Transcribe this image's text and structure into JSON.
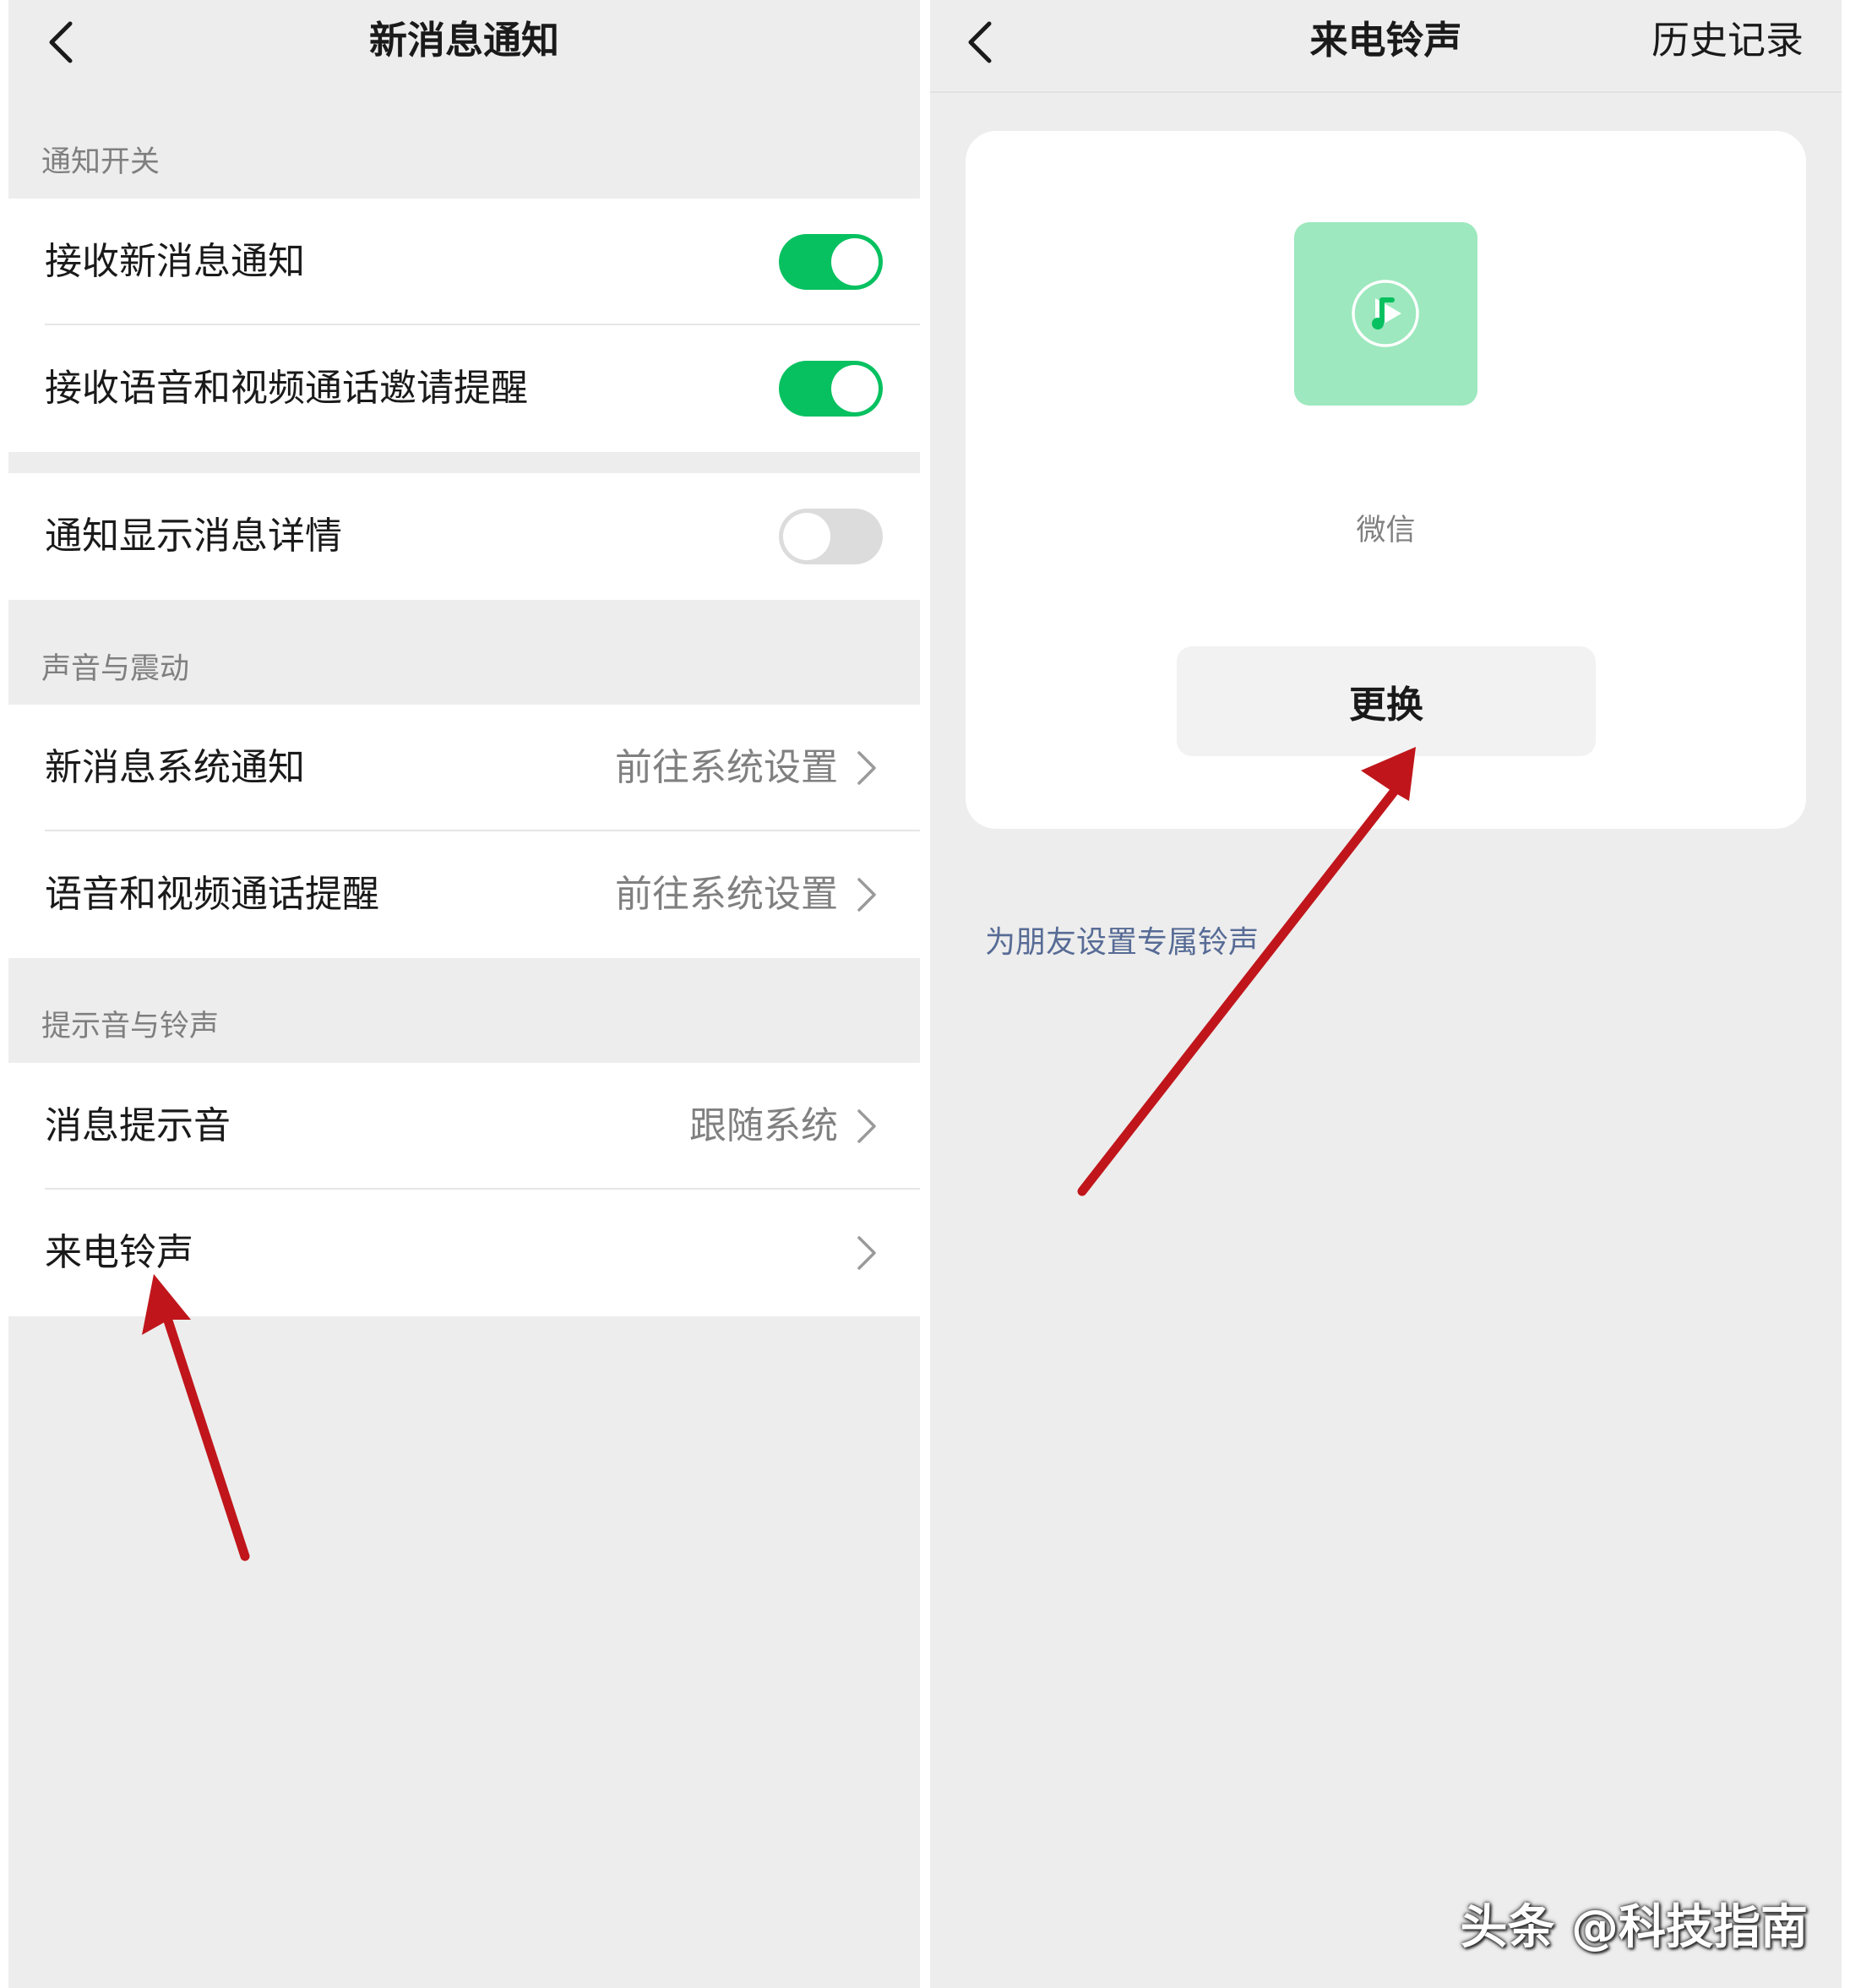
{
  "left": {
    "title": "新消息通知",
    "sections": {
      "notification_switch": "通知开关",
      "sound_vibration": "声音与震动",
      "tone_ringtone": "提示音与铃声"
    },
    "items": {
      "receive_new_message": {
        "label": "接收新消息通知",
        "toggle": "on"
      },
      "call_invite_reminder": {
        "label": "接收语音和视频通话邀请提醒",
        "toggle": "on"
      },
      "show_message_details": {
        "label": "通知显示消息详情",
        "toggle": "off"
      },
      "system_notification": {
        "label": "新消息系统通知",
        "value": "前往系统设置"
      },
      "call_reminder": {
        "label": "语音和视频通话提醒",
        "value": "前往系统设置"
      },
      "message_tone": {
        "label": "消息提示音",
        "value": "跟随系统"
      },
      "ringtone": {
        "label": "来电铃声"
      }
    }
  },
  "right": {
    "title": "来电铃声",
    "history_label": "历史记录",
    "ringtone_name": "微信",
    "change_label": "更换",
    "friend_ringtone_label": "为朋友设置专属铃声"
  },
  "watermark": "头条 @科技指南",
  "colors": {
    "accent_green": "#07c160",
    "toggle_off": "#dcdcdc",
    "link_blue": "#576b95",
    "cover_green": "#9de8be",
    "annotation_red": "#c0161b"
  }
}
